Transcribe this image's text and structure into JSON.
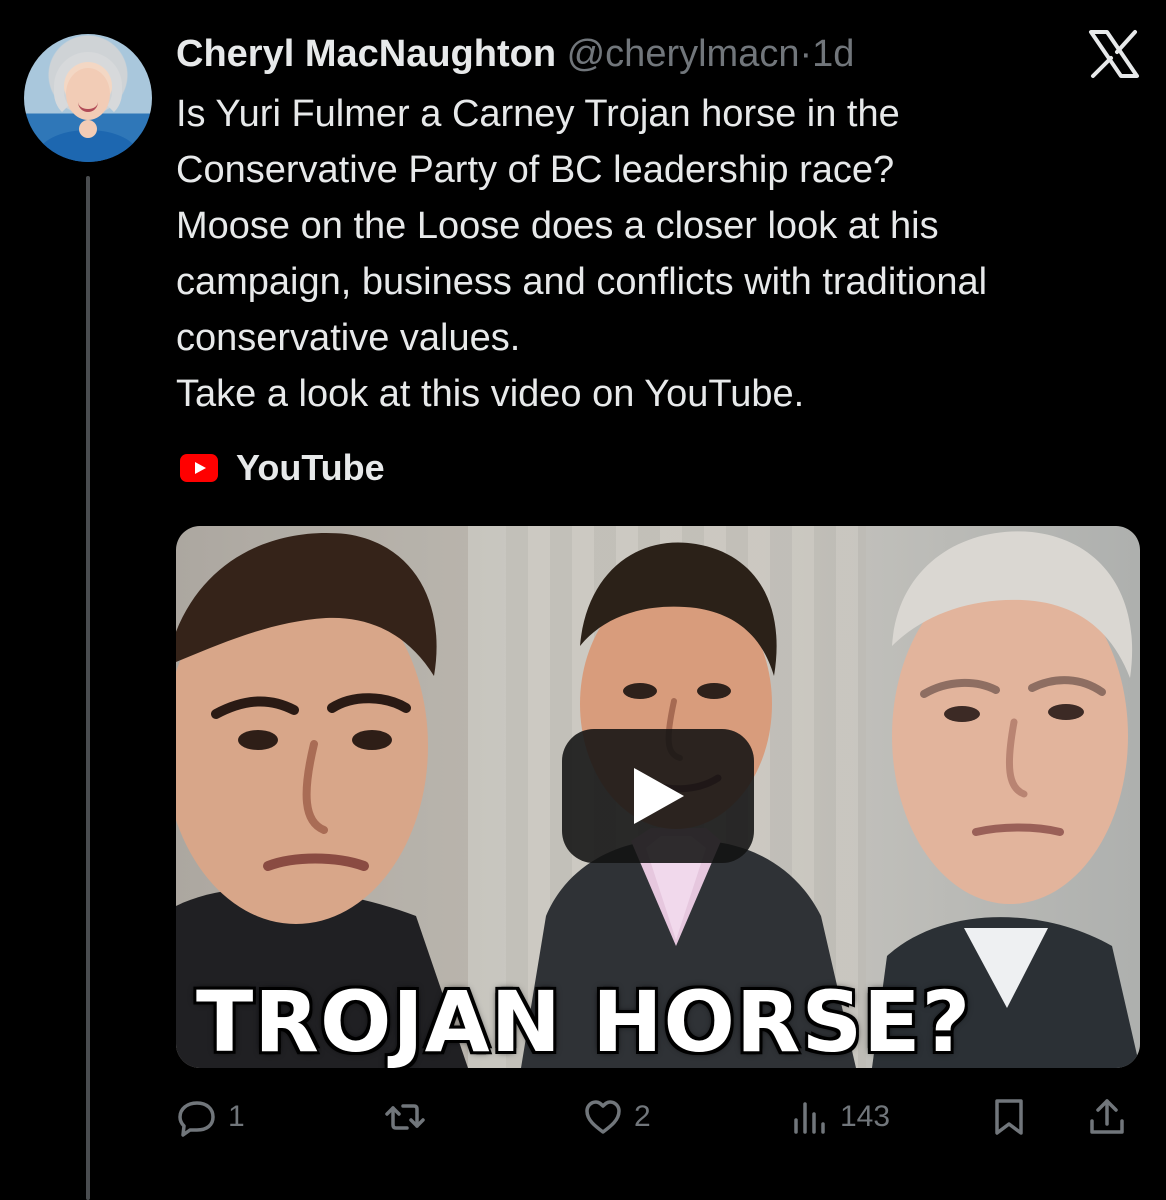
{
  "tweet": {
    "display_name": "Cheryl MacNaughton",
    "handle": "@cherylmacn",
    "separator": "·",
    "time": "1d",
    "text": "Is Yuri Fulmer a Carney Trojan horse in the\nConservative Party of BC leadership race?\nMoose on the Loose does a closer look at his\ncampaign, business and conflicts with traditional\nconservative values.\nTake a look at this video on YouTube."
  },
  "link_card": {
    "source": "YouTube",
    "thumbnail_text": "TROJAN HORSE?"
  },
  "actions": {
    "replies": "1",
    "reposts": "",
    "likes": "2",
    "views": "143"
  },
  "icons": {
    "platform_logo": "x-logo-icon",
    "source_icon": "youtube-icon",
    "reply": "reply-icon",
    "repost": "repost-icon",
    "like": "heart-icon",
    "views": "views-icon",
    "bookmark": "bookmark-icon",
    "share": "share-icon"
  },
  "colors": {
    "background": "#000000",
    "text": "#e7e9ea",
    "muted": "#71767b",
    "youtube_red": "#ff0000"
  }
}
